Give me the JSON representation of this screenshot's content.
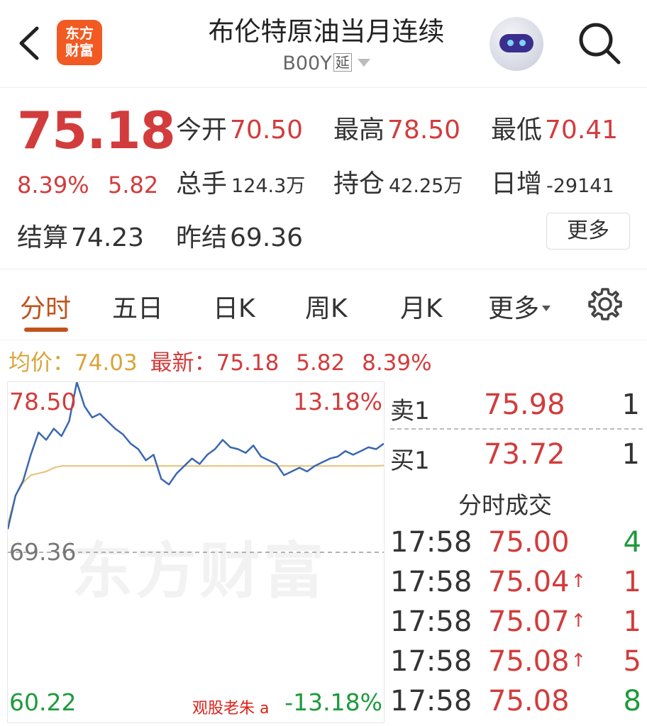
{
  "header": {
    "back_icon": "chevron-left-icon",
    "logo_line1": "东方",
    "logo_line2": "财富",
    "title": "布伦特原油当月连续",
    "code": "B00Y",
    "code_tag": "延",
    "avatar_icon": "robot-avatar-icon",
    "search_icon": "search-icon"
  },
  "quote": {
    "price": "75.18",
    "change_pct": "8.39%",
    "change": "5.82",
    "open_label": "今开",
    "open": "70.50",
    "high_label": "最高",
    "high": "78.50",
    "low_label": "最低",
    "low": "70.41",
    "volume_label": "总手",
    "volume": "124.3万",
    "oi_label": "持仓",
    "oi": "42.25万",
    "daily_inc_label": "日增",
    "daily_inc": "-29141",
    "settle_label": "结算",
    "settle": "74.23",
    "prev_settle_label": "昨结",
    "prev_settle": "69.36",
    "more_button": "更多"
  },
  "tabs": {
    "items": [
      {
        "label": "分时",
        "active": true
      },
      {
        "label": "五日"
      },
      {
        "label": "日K"
      },
      {
        "label": "周K"
      },
      {
        "label": "月K"
      },
      {
        "label": "更多"
      }
    ],
    "settings_icon": "gear-icon"
  },
  "legend": {
    "avg_label": "均价：",
    "avg": "74.03",
    "last_label": "最新：",
    "last": "75.18",
    "change": "5.82",
    "change_pct": "8.39%"
  },
  "chart": {
    "top_price": "78.50",
    "top_pct": "13.18%",
    "mid_price": "69.36",
    "bottom_price": "60.22",
    "bottom_pct": "-13.18%",
    "watermark": "东方财富",
    "credit": "观股老朱 a",
    "colors": {
      "price_line": "#3a67b0",
      "avg_line": "#e6c073",
      "up": "#d23c3c",
      "down": "#1e9a3c"
    }
  },
  "chart_data": {
    "type": "line",
    "ylim": [
      60.22,
      78.5
    ],
    "reference": 69.36,
    "series": [
      {
        "name": "最新",
        "values": [
          70.6,
          72.4,
          73.2,
          74.6,
          75.8,
          75.4,
          76.0,
          75.6,
          76.4,
          78.5,
          77.2,
          76.6,
          76.8,
          76.4,
          76.0,
          75.7,
          75.2,
          74.9,
          74.3,
          74.6,
          73.3,
          73.0,
          73.6,
          74.0,
          74.4,
          74.1,
          74.6,
          74.9,
          75.4,
          75.0,
          74.9,
          74.7,
          75.1,
          74.5,
          74.3,
          74.1,
          73.5,
          73.7,
          73.9,
          73.7,
          74.0,
          74.2,
          74.4,
          74.5,
          74.8,
          74.6,
          74.8,
          75.0,
          74.9,
          75.2
        ]
      },
      {
        "name": "均价",
        "values": [
          70.9,
          72.4,
          73.1,
          73.5,
          73.6,
          73.7,
          73.9,
          74.0,
          74.0,
          74.0,
          74.0,
          74.0,
          74.0,
          74.0,
          74.0,
          74.0,
          74.0,
          74.0,
          74.0,
          74.0,
          74.0,
          74.0,
          74.0,
          74.0,
          74.0,
          74.0,
          74.0,
          74.0,
          74.0,
          74.0,
          74.0,
          74.0,
          74.0,
          74.0,
          74.0,
          74.0,
          74.0,
          74.0,
          74.0,
          74.0,
          74.0,
          74.0,
          74.0,
          74.0,
          74.0,
          74.0,
          74.0,
          74.0,
          74.0,
          74.03
        ]
      }
    ]
  },
  "orderbook": {
    "ask_label": "卖1",
    "ask_price": "75.98",
    "ask_vol": "1",
    "bid_label": "买1",
    "bid_price": "73.72",
    "bid_vol": "1"
  },
  "trades": {
    "title": "分时成交",
    "rows": [
      {
        "time": "17:58",
        "price": "75.00",
        "arrow": "",
        "vol": "4",
        "dir": "down"
      },
      {
        "time": "17:58",
        "price": "75.04",
        "arrow": "↑",
        "vol": "1",
        "dir": "up"
      },
      {
        "time": "17:58",
        "price": "75.07",
        "arrow": "↑",
        "vol": "1",
        "dir": "up"
      },
      {
        "time": "17:58",
        "price": "75.08",
        "arrow": "↑",
        "vol": "5",
        "dir": "up"
      },
      {
        "time": "17:58",
        "price": "75.08",
        "arrow": "",
        "vol": "8",
        "dir": "down"
      }
    ]
  }
}
